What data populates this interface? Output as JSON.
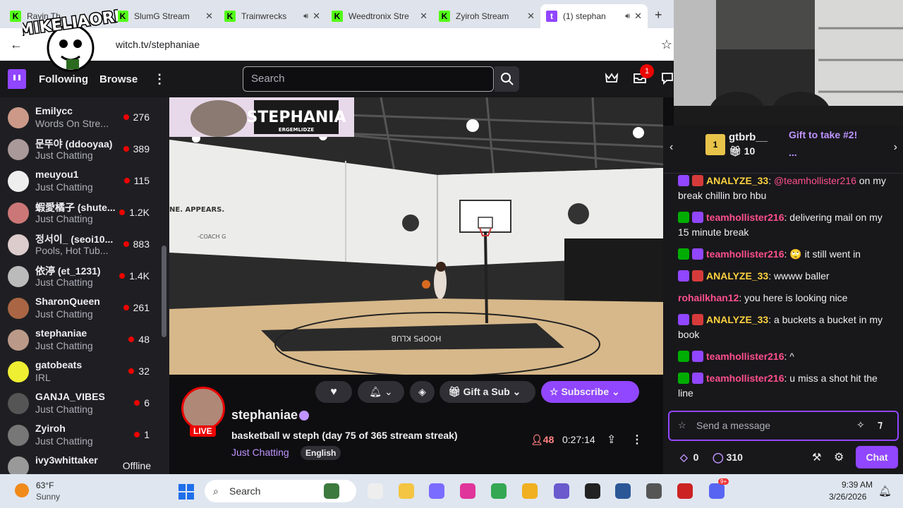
{
  "tabs": [
    {
      "title": "Rayin Th",
      "icon": "kick",
      "audio": true
    },
    {
      "title": "SlumG Stream",
      "icon": "kick",
      "audio": false
    },
    {
      "title": "Trainwrecks",
      "icon": "kick",
      "audio": true
    },
    {
      "title": "Weedtronix Stre",
      "icon": "kick",
      "audio": false
    },
    {
      "title": "Zyiroh Stream",
      "icon": "kick",
      "audio": false
    },
    {
      "title": "(1) stephan",
      "icon": "twitch",
      "audio": true
    }
  ],
  "address": {
    "url": "witch.tv/stephaniae"
  },
  "overlay_logo": "MIKELIAORI",
  "topnav": {
    "following": "Following",
    "browse": "Browse",
    "search_placeholder": "Search",
    "notif_count": "1"
  },
  "sidebar": [
    {
      "name": "Emilycc",
      "game": "Words On Stre...",
      "viewers": "276",
      "color": "#c98"
    },
    {
      "name": "문뚜야 (ddooyaa)",
      "game": "Just Chatting",
      "viewers": "389",
      "color": "#a99"
    },
    {
      "name": "meuyou1",
      "game": "Just Chatting",
      "viewers": "115",
      "color": "#eee"
    },
    {
      "name": "蝦愛橘子 (shute...",
      "game": "Just Chatting",
      "viewers": "1.2K",
      "color": "#c77"
    },
    {
      "name": "정서이_ (seoi10...",
      "game": "Pools, Hot Tub...",
      "viewers": "883",
      "color": "#dcc"
    },
    {
      "name": "依渟 (et_1231)",
      "game": "Just Chatting",
      "viewers": "1.4K",
      "color": "#bbb"
    },
    {
      "name": "SharonQueen",
      "game": "Just Chatting",
      "viewers": "261",
      "color": "#a64"
    },
    {
      "name": "stephaniae",
      "game": "Just Chatting",
      "viewers": "48",
      "color": "#b98"
    },
    {
      "name": "gatobeats",
      "game": "IRL",
      "viewers": "32",
      "color": "#ee3"
    },
    {
      "name": "GANJA_VIBES",
      "game": "Just Chatting",
      "viewers": "6",
      "color": "#555"
    },
    {
      "name": "Zyiroh",
      "game": "Just Chatting",
      "viewers": "1",
      "color": "#777"
    },
    {
      "name": "ivy3whittaker",
      "game": "",
      "viewers": "Offline",
      "color": "#999"
    }
  ],
  "video": {
    "banner": "STEPHANIA",
    "banner_sub": "ERGEMLIDZE",
    "court_text": "HOOPS KLUB",
    "wall_text": "NE. APPEARS.",
    "coach": "-COACH G"
  },
  "stream": {
    "streamer": "stephaniae",
    "title": "basketball w steph (day 75 of 365 stream streak)",
    "category": "Just Chatting",
    "tag": "English",
    "viewers": "48",
    "uptime": "0:27:14",
    "live": "LIVE",
    "gift": "Gift a Sub",
    "subscribe": "Subscribe"
  },
  "chat": {
    "gift_user": "gtbrb__",
    "gift_count": "10",
    "gift_badge": "1",
    "gift_text": "Gift to take #2!",
    "gift_more": "...",
    "messages": [
      {
        "badges": [
          "vip",
          "ppl"
        ],
        "user": "ANALYZE_33",
        "color": "#ffd23f",
        "text": ": @teamhollister216 on my break chillin bro hbu",
        "mention": "@teamhollister216",
        "rest": " on my break chillin bro hbu"
      },
      {
        "badges": [
          "mod",
          "vip"
        ],
        "user": "teamhollister216",
        "color": "#ff4f8b",
        "text": ": delivering mail on my 15 minute break"
      },
      {
        "badges": [
          "mod",
          "vip"
        ],
        "user": "teamhollister216",
        "color": "#ff4f8b",
        "text": ": 🙄 it still went in"
      },
      {
        "badges": [
          "vip",
          "ppl"
        ],
        "user": "ANALYZE_33",
        "color": "#ffd23f",
        "text": ": wwww baller"
      },
      {
        "badges": [],
        "user": "rohailkhan12",
        "color": "#ff4f8b",
        "text": ": you here is looking nice"
      },
      {
        "badges": [
          "vip",
          "ppl"
        ],
        "user": "ANALYZE_33",
        "color": "#ffd23f",
        "text": ": a buckets a bucket in my book"
      },
      {
        "badges": [
          "mod",
          "vip"
        ],
        "user": "teamhollister216",
        "color": "#ff4f8b",
        "text": ": ^"
      },
      {
        "badges": [
          "mod",
          "vip"
        ],
        "user": "teamhollister216",
        "color": "#ff4f8b",
        "text": ": u miss a shot hit the line"
      }
    ],
    "input_placeholder": "Send a message",
    "bits": "0",
    "points": "310",
    "chat_button": "Chat"
  },
  "taskbar": {
    "temp": "63°F",
    "weather": "Sunny",
    "search": "Search",
    "time": "9:39 AM",
    "date": "3/26/2026",
    "discord_badge": "9+"
  }
}
